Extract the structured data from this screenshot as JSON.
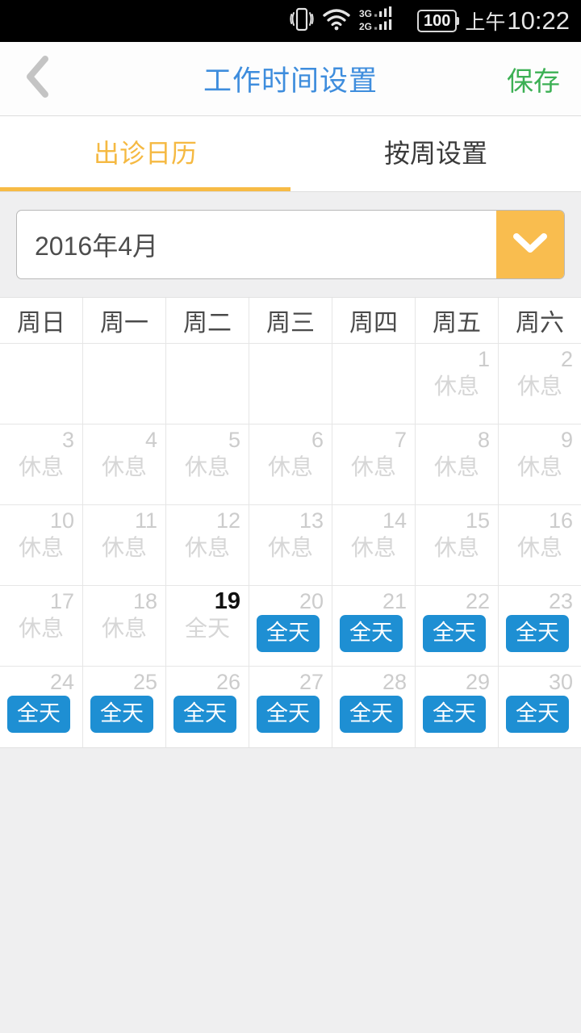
{
  "statusbar": {
    "icons": [
      "vibrate-icon",
      "wifi-icon",
      "dual-sim-signal-icon"
    ],
    "sim_labels": [
      "3G",
      "2G"
    ],
    "battery": "100",
    "ampm": "上午",
    "time": "10:22"
  },
  "header": {
    "back_icon": "chevron-left-icon",
    "title": "工作时间设置",
    "save_label": "保存",
    "title_color": "#3e8ddd",
    "save_color": "#3cb054"
  },
  "tabs": {
    "accent_color": "#f7bb45",
    "items": [
      {
        "label": "出诊日历",
        "active": true
      },
      {
        "label": "按周设置",
        "active": false
      }
    ]
  },
  "month_selector": {
    "value": "2016年4月",
    "arrow_icon": "chevron-down-icon",
    "arrow_bg": "#f9bd4f"
  },
  "calendar": {
    "weekday_headers": [
      "周日",
      "周一",
      "周二",
      "周三",
      "周四",
      "周五",
      "周六"
    ],
    "rest_label": "休息",
    "allday_label": "全天",
    "badge_color": "#1e8fd3",
    "weeks": [
      [
        {
          "day": "",
          "state": "empty"
        },
        {
          "day": "",
          "state": "empty"
        },
        {
          "day": "",
          "state": "empty"
        },
        {
          "day": "",
          "state": "empty"
        },
        {
          "day": "",
          "state": "empty"
        },
        {
          "day": "1",
          "state": "rest"
        },
        {
          "day": "2",
          "state": "rest"
        }
      ],
      [
        {
          "day": "3",
          "state": "rest"
        },
        {
          "day": "4",
          "state": "rest"
        },
        {
          "day": "5",
          "state": "rest"
        },
        {
          "day": "6",
          "state": "rest"
        },
        {
          "day": "7",
          "state": "rest"
        },
        {
          "day": "8",
          "state": "rest"
        },
        {
          "day": "9",
          "state": "rest"
        }
      ],
      [
        {
          "day": "10",
          "state": "rest"
        },
        {
          "day": "11",
          "state": "rest"
        },
        {
          "day": "12",
          "state": "rest"
        },
        {
          "day": "13",
          "state": "rest"
        },
        {
          "day": "14",
          "state": "rest"
        },
        {
          "day": "15",
          "state": "rest"
        },
        {
          "day": "16",
          "state": "rest"
        }
      ],
      [
        {
          "day": "17",
          "state": "rest"
        },
        {
          "day": "18",
          "state": "rest"
        },
        {
          "day": "19",
          "state": "allday-muted",
          "today": true
        },
        {
          "day": "20",
          "state": "allday-badge"
        },
        {
          "day": "21",
          "state": "allday-badge"
        },
        {
          "day": "22",
          "state": "allday-badge"
        },
        {
          "day": "23",
          "state": "allday-badge"
        }
      ],
      [
        {
          "day": "24",
          "state": "allday-badge"
        },
        {
          "day": "25",
          "state": "allday-badge"
        },
        {
          "day": "26",
          "state": "allday-badge"
        },
        {
          "day": "27",
          "state": "allday-badge"
        },
        {
          "day": "28",
          "state": "allday-badge"
        },
        {
          "day": "29",
          "state": "allday-badge"
        },
        {
          "day": "30",
          "state": "allday-badge"
        }
      ]
    ]
  }
}
